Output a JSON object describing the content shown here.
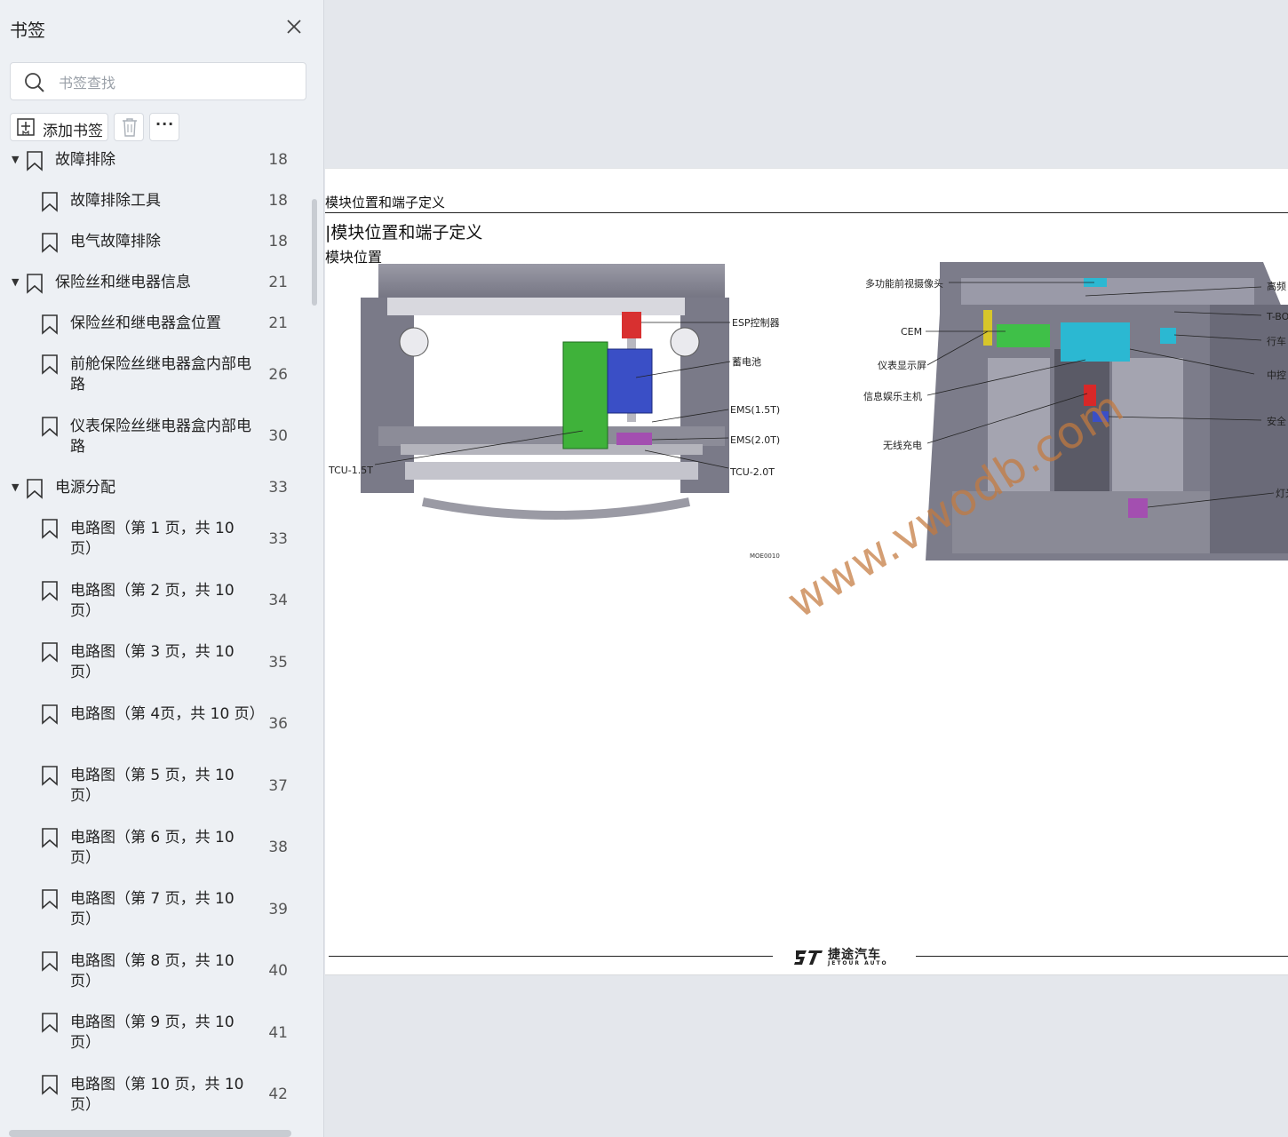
{
  "sidebar": {
    "title": "书签",
    "search_placeholder": "书签查找",
    "add_label": "添加书签",
    "more_label": "···",
    "items": [
      {
        "label": "故障排除",
        "page": "18",
        "level": 1,
        "expanded": true
      },
      {
        "label": "故障排除工具",
        "page": "18",
        "level": 2
      },
      {
        "label": "电气故障排除",
        "page": "18",
        "level": 2
      },
      {
        "label": "保险丝和继电器信息",
        "page": "21",
        "level": 1,
        "expanded": true
      },
      {
        "label": "保险丝和继电器盒位置",
        "page": "21",
        "level": 2
      },
      {
        "label": "前舱保险丝继电器盒内部电路",
        "page": "26",
        "level": 2
      },
      {
        "label": "仪表保险丝继电器盒内部电路",
        "page": "30",
        "level": 2
      },
      {
        "label": "电源分配",
        "page": "33",
        "level": 1,
        "expanded": true
      },
      {
        "label": "电路图（第 1 页，共 10 页）",
        "page": "33",
        "level": 2
      },
      {
        "label": "电路图（第 2 页，共 10 页）",
        "page": "34",
        "level": 2
      },
      {
        "label": "电路图（第 3 页，共 10 页）",
        "page": "35",
        "level": 2
      },
      {
        "label": "电路图（第 4页，共 10 页）",
        "page": "36",
        "level": 2
      },
      {
        "label": "电路图（第 5 页，共 10 页）",
        "page": "37",
        "level": 2
      },
      {
        "label": "电路图（第 6 页，共 10 页）",
        "page": "38",
        "level": 2
      },
      {
        "label": "电路图（第 7 页，共 10 页）",
        "page": "39",
        "level": 2
      },
      {
        "label": "电路图（第 8 页，共 10 页）",
        "page": "40",
        "level": 2
      },
      {
        "label": "电路图（第 9 页，共 10 页）",
        "page": "41",
        "level": 2
      },
      {
        "label": "电路图（第 10 页，共 10 页）",
        "page": "42",
        "level": 2
      }
    ]
  },
  "document": {
    "header": "模块位置和端子定义",
    "title": "|模块位置和端子定义",
    "subtitle": "模块位置",
    "figure_left": {
      "code": "MOE0010",
      "callouts": {
        "esp": "ESP控制器",
        "battery": "蓄电池",
        "ems15": "EMS(1.5T)",
        "ems20": "EMS(2.0T)",
        "tcu15": "TCU-1.5T",
        "tcu20": "TCU-2.0T"
      }
    },
    "figure_right": {
      "callouts": {
        "camera": "多功能前视摄像头",
        "cem": "CEM",
        "cluster": "仪表显示屏",
        "infotainment": "信息娱乐主机",
        "wireless": "无线充电",
        "r1": "高频",
        "r2": "T-BO",
        "r3": "行车",
        "r4": "中控",
        "r5": "安全",
        "r6": "灯光"
      }
    },
    "footer_logo_cn": "捷途汽车",
    "footer_logo_en": "JETOUR AUTO",
    "watermark": "www.vwodb.com"
  }
}
